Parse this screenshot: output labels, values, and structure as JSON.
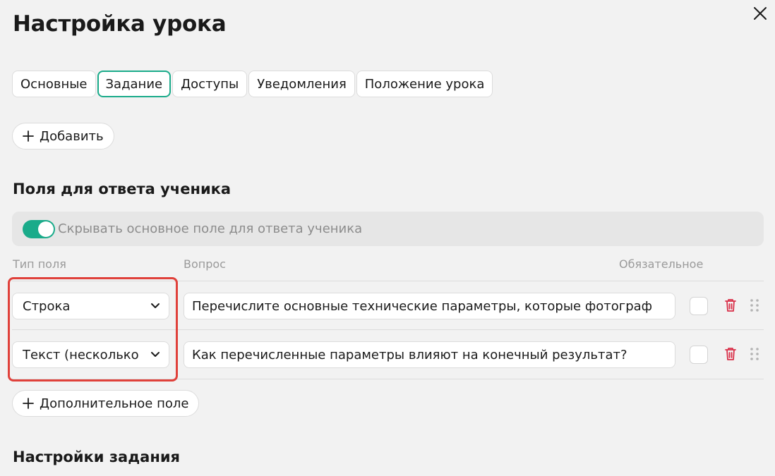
{
  "header": {
    "title": "Настройка урока"
  },
  "tabs": [
    {
      "label": "Основные",
      "active": false
    },
    {
      "label": "Задание",
      "active": true
    },
    {
      "label": "Доступы",
      "active": false
    },
    {
      "label": "Уведомления",
      "active": false
    },
    {
      "label": "Положение урока",
      "active": false
    }
  ],
  "add_button": {
    "label": "Добавить"
  },
  "answer_fields": {
    "title": "Поля для ответа ученика",
    "hide_main_toggle": {
      "label": "Скрывать основное поле для ответа ученика",
      "on": true
    },
    "columns": {
      "type": "Тип поля",
      "question": "Вопрос",
      "required": "Обязательное"
    },
    "rows": [
      {
        "type": "Строка",
        "question": "Перечислите основные технические параметры, которые фотограф",
        "required": false
      },
      {
        "type": "Текст (несколько",
        "question": "Как перечисленные параметры влияют на конечный результат?",
        "required": false
      }
    ],
    "extra_button": {
      "label": "Дополнительное поле"
    }
  },
  "task_settings": {
    "title": "Настройки задания"
  },
  "colors": {
    "accent": "#1aab8a",
    "danger": "#e0413b",
    "trash": "#d9314a"
  },
  "icons": {
    "close": "close-icon",
    "plus": "plus-icon",
    "chevron": "chevron-down-icon",
    "trash": "trash-icon",
    "drag": "drag-handle-icon"
  }
}
